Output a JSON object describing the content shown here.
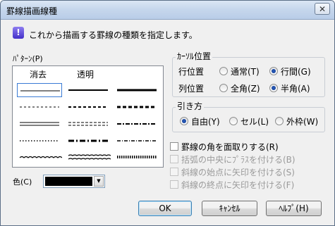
{
  "window": {
    "title": "罫線描画線種",
    "close_label": "✕"
  },
  "info": {
    "icon": "!",
    "text": "これから描画する罫線の種類を指定します。"
  },
  "pattern": {
    "label": "ﾊﾟﾀｰﾝ(P)",
    "headers": [
      "消去",
      "透明"
    ],
    "rows": [
      [
        "thin-solid",
        "medium-solid",
        "thick-solid"
      ],
      [
        "fine-dash",
        "dash",
        "bold-dash"
      ],
      [
        "double",
        "double-dash",
        "dash-dot"
      ],
      [
        "dots",
        "bold-dot-dash",
        "dot-dash"
      ],
      [
        "wave",
        "double-wave",
        "hatched"
      ]
    ],
    "selected": "0-0"
  },
  "cursor_position": {
    "title": "ｶｰｿﾙ位置",
    "row_label": "行位置",
    "row_options": [
      "通常(T)",
      "行間(G)"
    ],
    "row_selected": 1,
    "col_label": "列位置",
    "col_options": [
      "全角(Z)",
      "半角(A)"
    ],
    "col_selected": 1
  },
  "draw_method": {
    "title": "引き方",
    "options": [
      "自由(Y)",
      "セル(L)",
      "外枠(W)"
    ],
    "selected": 0
  },
  "checkboxes": [
    {
      "label": "罫線の角を面取りする(R)",
      "enabled": true
    },
    {
      "label": "括弧の中央にﾌﾟﾗｽを付ける(B)",
      "enabled": false
    },
    {
      "label": "斜線の始点に矢印を付ける(S)",
      "enabled": false
    },
    {
      "label": "斜線の終点に矢印を付ける(F)",
      "enabled": false
    }
  ],
  "color": {
    "label": "色(C)",
    "value": "#000000"
  },
  "buttons": {
    "ok": "OK",
    "cancel": "ｷｬﾝｾﾙ",
    "help": "ﾍﾙﾌﾟ(H)"
  }
}
